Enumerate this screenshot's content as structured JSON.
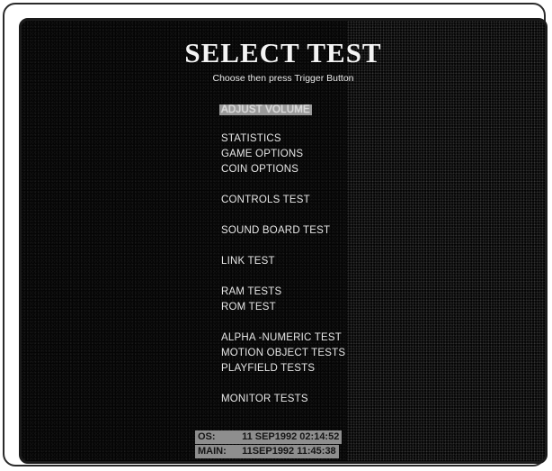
{
  "screen": {
    "title": "SELECT TEST",
    "subtitle": "Choose then press Trigger Button"
  },
  "menu": {
    "items": [
      {
        "label": "ADJUST VOLUME",
        "selected": true
      },
      {
        "label": "STATISTICS"
      },
      {
        "label": "GAME OPTIONS"
      },
      {
        "label": "COIN OPTIONS"
      },
      {
        "label": "CONTROLS TEST"
      },
      {
        "label": "SOUND BOARD TEST"
      },
      {
        "label": "LINK TEST"
      },
      {
        "label": "RAM TESTS"
      },
      {
        "label": "ROM TEST"
      },
      {
        "label": "ALPHA -NUMERIC TEST"
      },
      {
        "label": "MOTION OBJECT TESTS"
      },
      {
        "label": "PLAYFIELD TESTS"
      },
      {
        "label": "MONITOR TESTS"
      }
    ]
  },
  "versions": [
    {
      "label": "OS:",
      "date": "11 SEP1992",
      "time": "02:14:52"
    },
    {
      "label": "MAIN:",
      "date": "11SEP1992",
      "time": "11:45:38"
    }
  ],
  "colors": {
    "background": "#050505",
    "text": "#e6e6e6",
    "highlight": "#9a9a9a"
  }
}
